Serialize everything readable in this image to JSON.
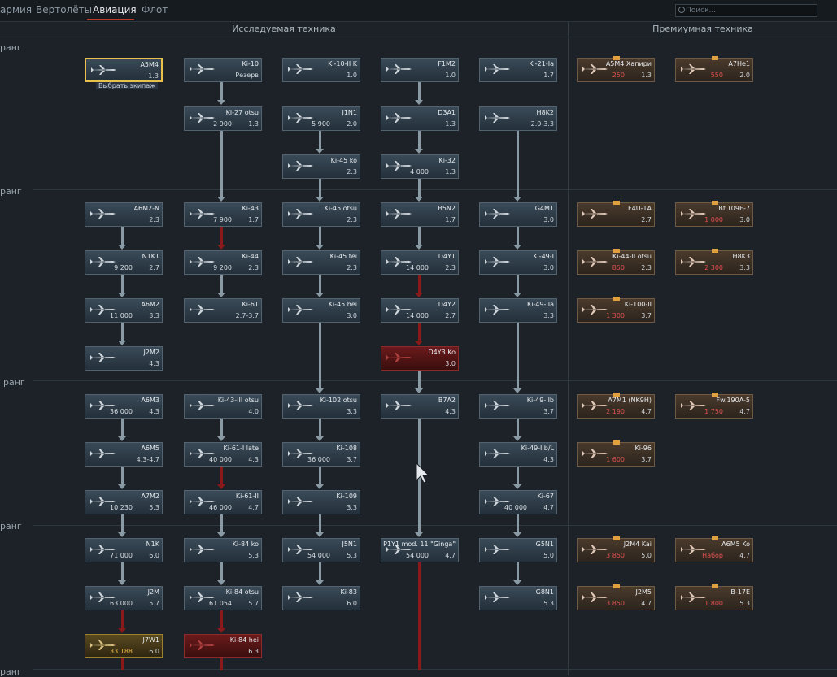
{
  "tabs": [
    {
      "label": "армия",
      "active": false
    },
    {
      "label": "Вертолёты",
      "active": false
    },
    {
      "label": "Авиация",
      "active": true
    },
    {
      "label": "Флот",
      "active": false
    }
  ],
  "search": {
    "placeholder": "Поиск..."
  },
  "sections": {
    "researched": "Исследуемая техника",
    "premium": "Премиумная техника"
  },
  "ranks": [
    "ранг",
    "ранг",
    "ранг",
    "ранг",
    "ранг"
  ],
  "tooltip": "Выбрать экипаж",
  "colors": {
    "accent": "#c0392b",
    "selected": "#e8c04a",
    "premium_cost": "#e05050"
  },
  "vehicles": [
    {
      "id": "a5m4",
      "name": "A5M4",
      "br": "1.3",
      "cost": "",
      "kind": "normal",
      "selected": true
    },
    {
      "id": "ki10",
      "name": "Ki-10",
      "br": "Резерв",
      "cost": "",
      "kind": "normal"
    },
    {
      "id": "ki10iik",
      "name": "Ki-10-II K",
      "br": "1.0",
      "cost": "",
      "kind": "normal"
    },
    {
      "id": "f1m2",
      "name": "F1M2",
      "br": "1.0",
      "cost": "",
      "kind": "normal"
    },
    {
      "id": "ki21ia",
      "name": "Ki-21-Ia",
      "br": "1.7",
      "cost": "",
      "kind": "normal"
    },
    {
      "id": "ki27otsu",
      "name": "Ki-27 otsu",
      "br": "1.3",
      "cost": "2 900",
      "kind": "normal"
    },
    {
      "id": "j1n1",
      "name": "J1N1",
      "br": "2.0",
      "cost": "5 900",
      "kind": "normal"
    },
    {
      "id": "d3a1",
      "name": "D3A1",
      "br": "1.3",
      "cost": "",
      "kind": "normal"
    },
    {
      "id": "h8k2",
      "name": "H8K2",
      "br": "2.0-3.3",
      "cost": "",
      "kind": "normal"
    },
    {
      "id": "ki45ko",
      "name": "Ki-45 ko",
      "br": "2.3",
      "cost": "",
      "kind": "normal"
    },
    {
      "id": "ki32",
      "name": "Ki-32",
      "br": "1.3",
      "cost": "4 000",
      "kind": "normal"
    },
    {
      "id": "a6m2n",
      "name": "A6M2-N",
      "br": "2.3",
      "cost": "",
      "kind": "normal"
    },
    {
      "id": "ki43",
      "name": "Ki-43",
      "br": "1.7",
      "cost": "7 900",
      "kind": "normal"
    },
    {
      "id": "ki45otsu",
      "name": "Ki-45 otsu",
      "br": "2.3",
      "cost": "",
      "kind": "normal"
    },
    {
      "id": "b5n2",
      "name": "B5N2",
      "br": "1.7",
      "cost": "",
      "kind": "normal"
    },
    {
      "id": "g4m1",
      "name": "G4M1",
      "br": "3.0",
      "cost": "",
      "kind": "normal"
    },
    {
      "id": "n1k1",
      "name": "N1K1",
      "br": "2.7",
      "cost": "9 200",
      "kind": "normal"
    },
    {
      "id": "ki44",
      "name": "Ki-44",
      "br": "2.3",
      "cost": "9 200",
      "kind": "normal"
    },
    {
      "id": "ki45tei",
      "name": "Ki-45 tei",
      "br": "2.3",
      "cost": "",
      "kind": "normal"
    },
    {
      "id": "d4y1",
      "name": "D4Y1",
      "br": "2.3",
      "cost": "14 000",
      "kind": "normal"
    },
    {
      "id": "ki49i",
      "name": "Ki-49-I",
      "br": "3.0",
      "cost": "",
      "kind": "normal"
    },
    {
      "id": "a6m2",
      "name": "A6M2",
      "br": "3.3",
      "cost": "11 000",
      "kind": "normal"
    },
    {
      "id": "ki61",
      "name": "Ki-61",
      "br": "2.7-3.7",
      "cost": "",
      "kind": "normal"
    },
    {
      "id": "ki45hei",
      "name": "Ki-45 hei",
      "br": "3.0",
      "cost": "",
      "kind": "normal"
    },
    {
      "id": "d4y2",
      "name": "D4Y2",
      "br": "2.7",
      "cost": "14 000",
      "kind": "normal"
    },
    {
      "id": "ki49iia",
      "name": "Ki-49-IIa",
      "br": "3.3",
      "cost": "",
      "kind": "normal"
    },
    {
      "id": "j2m2",
      "name": "J2M2",
      "br": "4.3",
      "cost": "",
      "kind": "normal"
    },
    {
      "id": "d4y3ko",
      "name": "D4Y3 Ko",
      "br": "3.0",
      "cost": "",
      "kind": "red"
    },
    {
      "id": "a6m3",
      "name": "A6M3",
      "br": "4.3",
      "cost": "36 000",
      "kind": "normal"
    },
    {
      "id": "ki43iiiotsu",
      "name": "Ki-43-III otsu",
      "br": "4.0",
      "cost": "",
      "kind": "normal"
    },
    {
      "id": "ki102otsu",
      "name": "Ki-102 otsu",
      "br": "3.3",
      "cost": "",
      "kind": "normal"
    },
    {
      "id": "b7a2",
      "name": "B7A2",
      "br": "4.3",
      "cost": "",
      "kind": "normal"
    },
    {
      "id": "ki49iib",
      "name": "Ki-49-IIb",
      "br": "3.7",
      "cost": "",
      "kind": "normal"
    },
    {
      "id": "a6m5",
      "name": "A6M5",
      "br": "4.3-4.7",
      "cost": "",
      "kind": "normal"
    },
    {
      "id": "ki61ilate",
      "name": "Ki-61-I late",
      "br": "4.3",
      "cost": "40 000",
      "kind": "normal"
    },
    {
      "id": "ki108",
      "name": "Ki-108",
      "br": "3.7",
      "cost": "36 000",
      "kind": "normal"
    },
    {
      "id": "ki49iibl",
      "name": "Ki-49-IIb/L",
      "br": "4.3",
      "cost": "",
      "kind": "normal"
    },
    {
      "id": "a7m2",
      "name": "A7M2",
      "br": "5.3",
      "cost": "10 230",
      "kind": "normal"
    },
    {
      "id": "ki61ii",
      "name": "Ki-61-II",
      "br": "4.7",
      "cost": "46 000",
      "kind": "normal"
    },
    {
      "id": "ki109",
      "name": "Ki-109",
      "br": "3.3",
      "cost": "",
      "kind": "normal"
    },
    {
      "id": "ki67",
      "name": "Ki-67",
      "br": "4.7",
      "cost": "40 000",
      "kind": "normal"
    },
    {
      "id": "n1k",
      "name": "N1K",
      "br": "6.0",
      "cost": "71 000",
      "kind": "normal"
    },
    {
      "id": "ki84ko",
      "name": "Ki-84 ko",
      "br": "5.3",
      "cost": "",
      "kind": "normal"
    },
    {
      "id": "j5n1",
      "name": "J5N1",
      "br": "5.3",
      "cost": "54 000",
      "kind": "normal"
    },
    {
      "id": "p1y1",
      "name": "P1Y1 mod. 11 \"Ginga\"",
      "br": "4.7",
      "cost": "54 000",
      "kind": "normal"
    },
    {
      "id": "g5n1",
      "name": "G5N1",
      "br": "5.0",
      "cost": "",
      "kind": "normal"
    },
    {
      "id": "j2m",
      "name": "J2M",
      "br": "5.7",
      "cost": "63 000",
      "kind": "normal"
    },
    {
      "id": "ki84otsu",
      "name": "Ki-84 otsu",
      "br": "5.7",
      "cost": "61 054",
      "kind": "normal"
    },
    {
      "id": "ki83",
      "name": "Ki-83",
      "br": "6.0",
      "cost": "",
      "kind": "normal"
    },
    {
      "id": "g8n1",
      "name": "G8N1",
      "br": "5.3",
      "cost": "",
      "kind": "normal"
    },
    {
      "id": "j7w1",
      "name": "J7W1",
      "br": "6.0",
      "cost": "33 188",
      "kind": "gold"
    },
    {
      "id": "ki84hei",
      "name": "Ki-84 hei",
      "br": "6.3",
      "cost": "",
      "kind": "red"
    },
    {
      "id": "p_a5m4",
      "name": "A5M4 Хапири",
      "br": "1.3",
      "cost": "250",
      "kind": "prem"
    },
    {
      "id": "p_a7he1",
      "name": "A7He1",
      "br": "2.0",
      "cost": "550",
      "kind": "prem"
    },
    {
      "id": "p_f4u1a",
      "name": "F4U-1A",
      "br": "2.7",
      "cost": "",
      "kind": "prem"
    },
    {
      "id": "p_bf109e7",
      "name": "Bf.109E-7",
      "br": "3.0",
      "cost": "1 000",
      "kind": "prem"
    },
    {
      "id": "p_ki44iiotsu",
      "name": "Ki-44-II otsu",
      "br": "2.3",
      "cost": "850",
      "kind": "prem"
    },
    {
      "id": "p_h8k3",
      "name": "H8K3",
      "br": "3.3",
      "cost": "2 300",
      "kind": "prem"
    },
    {
      "id": "p_ki100ii",
      "name": "Ki-100-II",
      "br": "3.7",
      "cost": "1 300",
      "kind": "prem"
    },
    {
      "id": "p_a7m1",
      "name": "A7M1 (NK9H)",
      "br": "4.7",
      "cost": "2 190",
      "kind": "prem"
    },
    {
      "id": "p_fw190a5",
      "name": "Fw.190A-5",
      "br": "4.7",
      "cost": "1 750",
      "kind": "prem"
    },
    {
      "id": "p_ki96",
      "name": "Ki-96",
      "br": "3.7",
      "cost": "1 600",
      "kind": "prem"
    },
    {
      "id": "p_j2m4kai",
      "name": "J2M4 Kai",
      "br": "5.0",
      "cost": "3 850",
      "kind": "prem"
    },
    {
      "id": "p_a6m5ko",
      "name": "A6M5 Ko",
      "br": "4.7",
      "cost": "Набор",
      "kind": "prem"
    },
    {
      "id": "p_j2m5",
      "name": "J2M5",
      "br": "4.7",
      "cost": "3 850",
      "kind": "prem"
    },
    {
      "id": "p_b17e",
      "name": "B-17E",
      "br": "5.3",
      "cost": "1 800",
      "kind": "prem"
    }
  ]
}
